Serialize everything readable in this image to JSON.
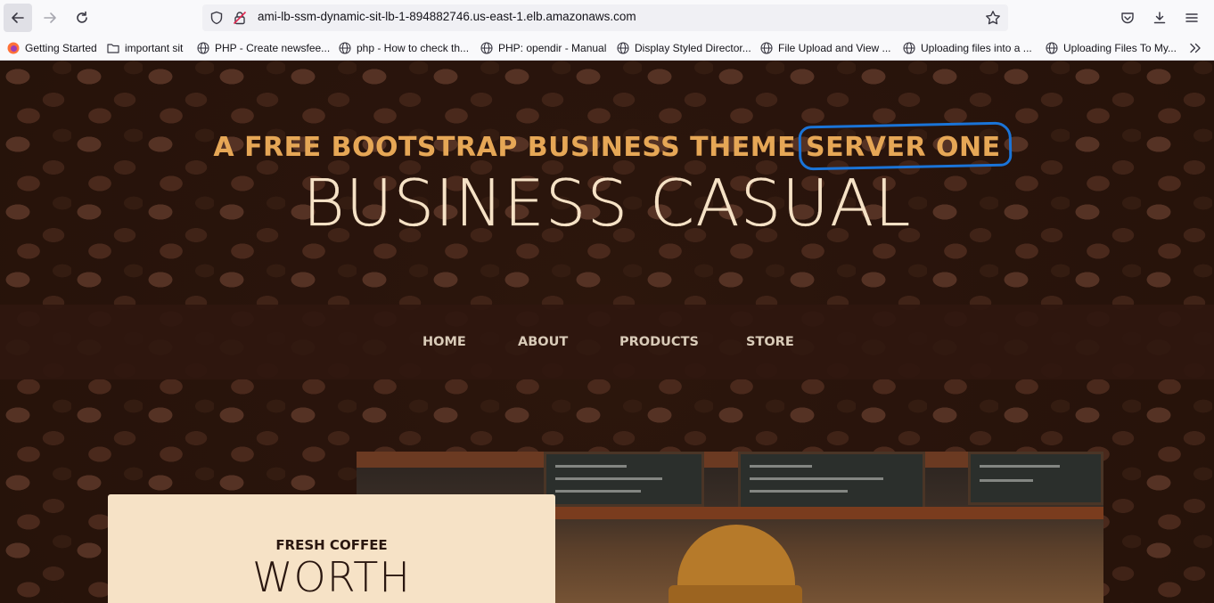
{
  "browser": {
    "url": "ami-lb-ssm-dynamic-sit-lb-1-894882746.us-east-1.elb.amazonaws.com",
    "icons": {
      "back": "arrow-left-icon",
      "forward": "arrow-right-icon",
      "reload": "reload-icon",
      "shield": "shield-icon",
      "insecure": "insecure-lock-icon",
      "bookmark": "star-icon",
      "pocket": "pocket-icon",
      "downloads": "download-icon",
      "menu": "hamburger-menu-icon",
      "overflow": "chevrons-right-icon"
    }
  },
  "bookmarks": [
    {
      "label": "Getting Started",
      "icon": "firefox-icon"
    },
    {
      "label": "important sit",
      "icon": "folder-icon"
    },
    {
      "label": "PHP - Create newsfee...",
      "icon": "globe-icon"
    },
    {
      "label": "php - How to check th...",
      "icon": "globe-icon"
    },
    {
      "label": "PHP: opendir - Manual",
      "icon": "globe-icon"
    },
    {
      "label": "Display Styled Director...",
      "icon": "globe-icon"
    },
    {
      "label": "File Upload and View ...",
      "icon": "globe-icon"
    },
    {
      "label": "Uploading files into a ...",
      "icon": "globe-icon"
    },
    {
      "label": "Uploading Files To My...",
      "icon": "globe-icon"
    }
  ],
  "hero": {
    "tagline_main": "A FREE BOOTSTRAP BUSINESS THEME",
    "tagline_highlight": "SERVER ONE",
    "brand": "BUSINESS CASUAL",
    "highlight_color": "#1a74d8",
    "accent_color": "#e6a756"
  },
  "nav": [
    {
      "label": "HOME"
    },
    {
      "label": "ABOUT"
    },
    {
      "label": "PRODUCTS"
    },
    {
      "label": "STORE"
    }
  ],
  "feature": {
    "subtitle": "FRESH COFFEE",
    "title": "WORTH"
  }
}
